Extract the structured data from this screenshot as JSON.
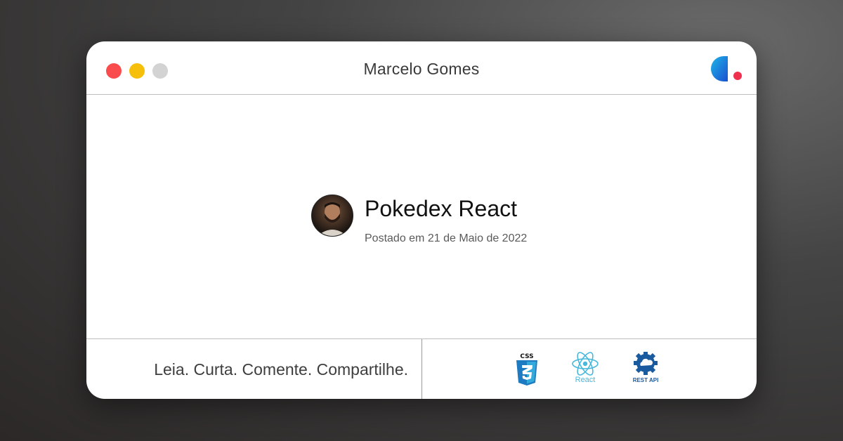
{
  "window": {
    "title": "Marcelo Gomes"
  },
  "post": {
    "title": "Pokedex React",
    "date": "Postado em 21 de Maio de 2022"
  },
  "footer": {
    "tagline": "Leia. Curta. Comente. Compartilhe.",
    "technologies": [
      {
        "icon": "css3-icon",
        "label": "CSS"
      },
      {
        "icon": "react-icon",
        "label": "React"
      },
      {
        "icon": "rest-api-icon",
        "label": "REST API"
      }
    ]
  },
  "colors": {
    "close": "#fa4c4c",
    "minimize": "#f6bf0c",
    "maximize": "#d3d3d3",
    "brand_blue": "#1a6fd8",
    "brand_red": "#f0304f",
    "css_blue": "#1f7bc1",
    "react_cyan": "#47b8dc"
  }
}
